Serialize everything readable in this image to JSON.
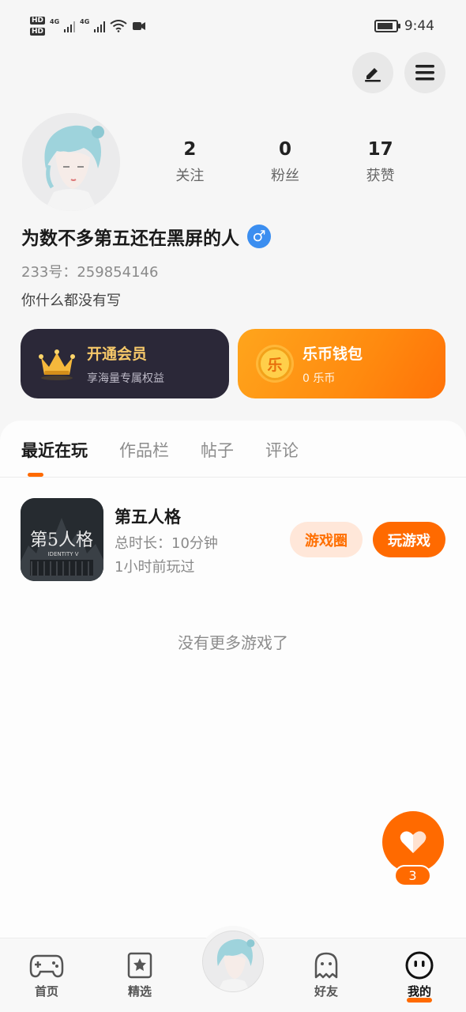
{
  "status_bar": {
    "hd1": "HD",
    "hd2": "HD",
    "net1": "4G",
    "net2": "4G",
    "time": "9:44",
    "battery_level": 0.85
  },
  "header": {
    "edit_icon": "pen-icon",
    "menu_icon": "hamburger-menu-icon"
  },
  "profile": {
    "avatar_icon": "user-avatar",
    "stats": [
      {
        "value": "2",
        "label": "关注"
      },
      {
        "value": "0",
        "label": "粉丝"
      },
      {
        "value": "17",
        "label": "获赞"
      }
    ],
    "nickname": "为数不多第五还在黑屏的人",
    "gender_symbol": "♂",
    "uid": "233号：259854146",
    "bio": "你什么都没有写"
  },
  "cards": {
    "vip": {
      "title": "开通会员",
      "subtitle": "享海量专属权益",
      "icon": "crown-icon",
      "title_color": "#f6c869"
    },
    "wallet": {
      "title": "乐币钱包",
      "subtitle": "0 乐币",
      "icon": "coin-icon",
      "coin_char": "乐"
    }
  },
  "tabs": [
    {
      "label": "最近在玩",
      "active": true
    },
    {
      "label": "作品栏",
      "active": false
    },
    {
      "label": "帖子",
      "active": false
    },
    {
      "label": "评论",
      "active": false
    }
  ],
  "recent_game": {
    "title": "第五人格",
    "icon_text": "第5人格",
    "icon_subtext": "IDENTITY V",
    "playtime": "总时长：10分钟",
    "last_played": "1小时前玩过",
    "circle_button": "游戏圈",
    "play_button": "玩游戏"
  },
  "empty_text": "没有更多游戏了",
  "float_like": {
    "icon": "heart-icon",
    "count": "3"
  },
  "bottom_nav": [
    {
      "label": "首页",
      "icon": "gamepad-icon"
    },
    {
      "label": "精选",
      "icon": "star-bookmark-icon"
    },
    {
      "label": "",
      "icon": "center-avatar"
    },
    {
      "label": "好友",
      "icon": "ghost-icon"
    },
    {
      "label": "我的",
      "icon": "smiley-face-icon"
    }
  ],
  "colors": {
    "accent": "#ff6a00",
    "gender_blue": "#3b8ef0",
    "vip_card": "#2b2838"
  }
}
